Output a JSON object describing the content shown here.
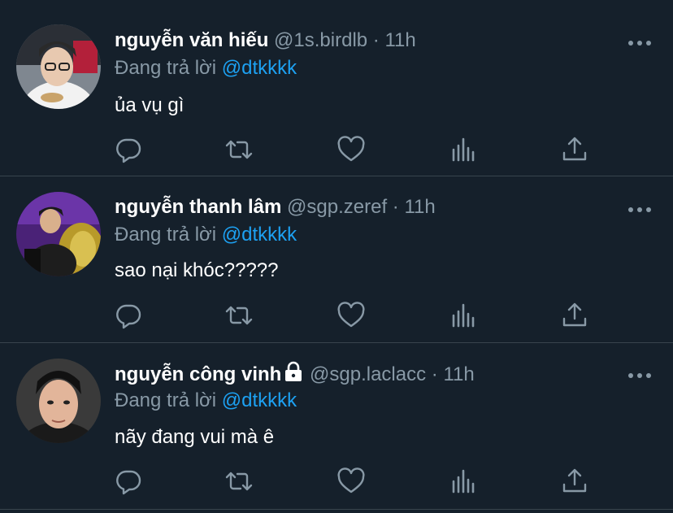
{
  "tweets": [
    {
      "name": "nguyễn văn hiếu",
      "handle": "@1s.birdlb",
      "separator": "·",
      "time": "11h",
      "replying_label": "Đang trả lời",
      "mention": "@dtkkkk",
      "text": "ủa vụ gì",
      "locked": false,
      "avatar_colors": {
        "bg": "#9aa0a6",
        "shirt": "#f2f2f2",
        "hair": "#2a2a2a",
        "skin": "#e8c9b0"
      }
    },
    {
      "name": "nguyễn thanh lâm",
      "handle": "@sgp.zeref",
      "separator": "·",
      "time": "11h",
      "replying_label": "Đang trả lời",
      "mention": "@dtkkkk",
      "text": "sao nại khóc?????",
      "locked": false,
      "avatar_colors": {
        "bg": "#5b2a86",
        "shirt": "#1d1d1d",
        "hair": "#1a1a1a",
        "skin": "#d9b08c"
      }
    },
    {
      "name": "nguyễn công vinh",
      "handle": "@sgp.laclacc",
      "separator": "·",
      "time": "11h",
      "replying_label": "Đang trả lời",
      "mention": "@dtkkkk",
      "text": "nãy đang vui mà ê",
      "locked": true,
      "avatar_colors": {
        "bg": "#2e2e2e",
        "shirt": "#1a1a1a",
        "hair": "#111111",
        "skin": "#e2b59a"
      }
    }
  ],
  "colors": {
    "background": "#15202b",
    "secondary_text": "#8899a6",
    "accent": "#1da1f2",
    "divider": "#38444d"
  },
  "icons": [
    "reply-icon",
    "retweet-icon",
    "like-icon",
    "analytics-icon",
    "share-icon",
    "more-icon",
    "lock-icon"
  ]
}
